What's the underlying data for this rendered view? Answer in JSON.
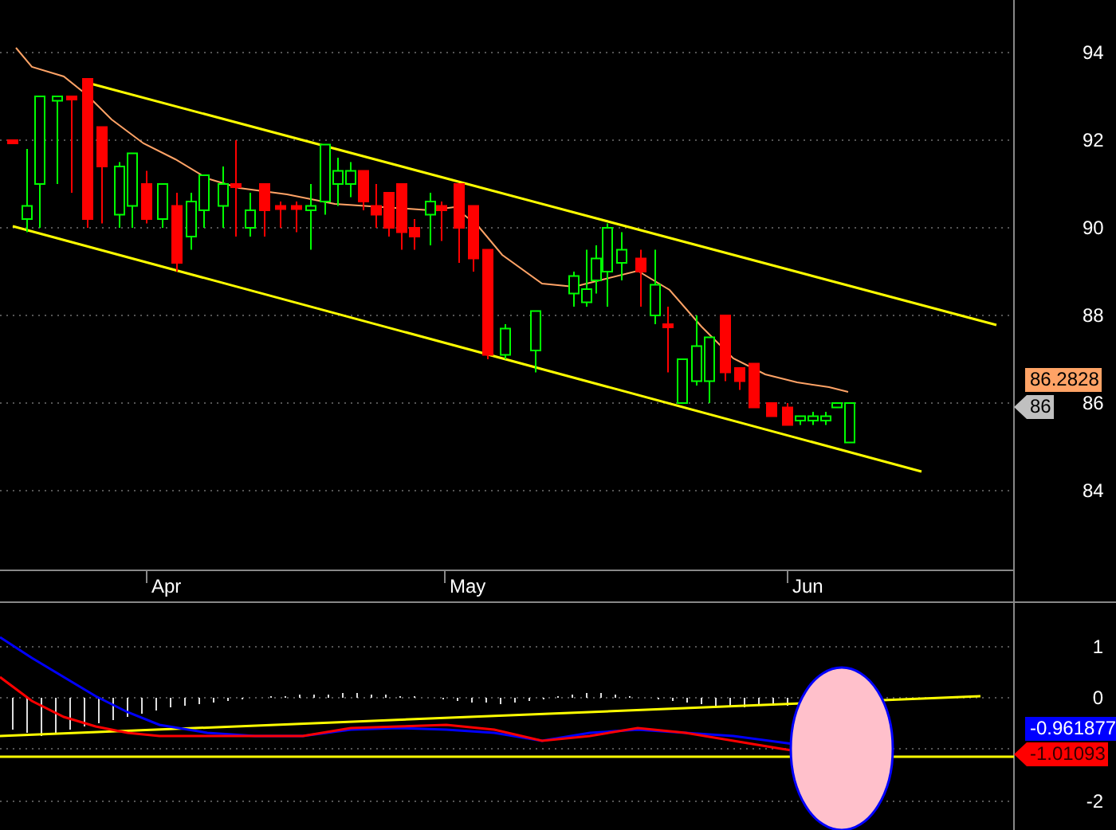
{
  "price_panel": {
    "y_axis_labels": [
      "94",
      "92",
      "90",
      "88",
      "86",
      "84"
    ],
    "price_tags": [
      {
        "text": "86.2828",
        "kind": "box",
        "color": "#ffa366"
      },
      {
        "text": "86",
        "kind": "arrow",
        "color": "#c0c0c0"
      }
    ]
  },
  "date_axis": {
    "labels": [
      "Apr",
      "May",
      "Jun"
    ]
  },
  "indicator_panel": {
    "y_axis_labels": [
      "1",
      "0",
      "-2"
    ],
    "value_tags": [
      {
        "text": "-0.961877",
        "kind": "box",
        "color": "#0000ff"
      },
      {
        "text": "-1.01093",
        "kind": "arrow",
        "color": "#ff0000"
      }
    ]
  }
}
